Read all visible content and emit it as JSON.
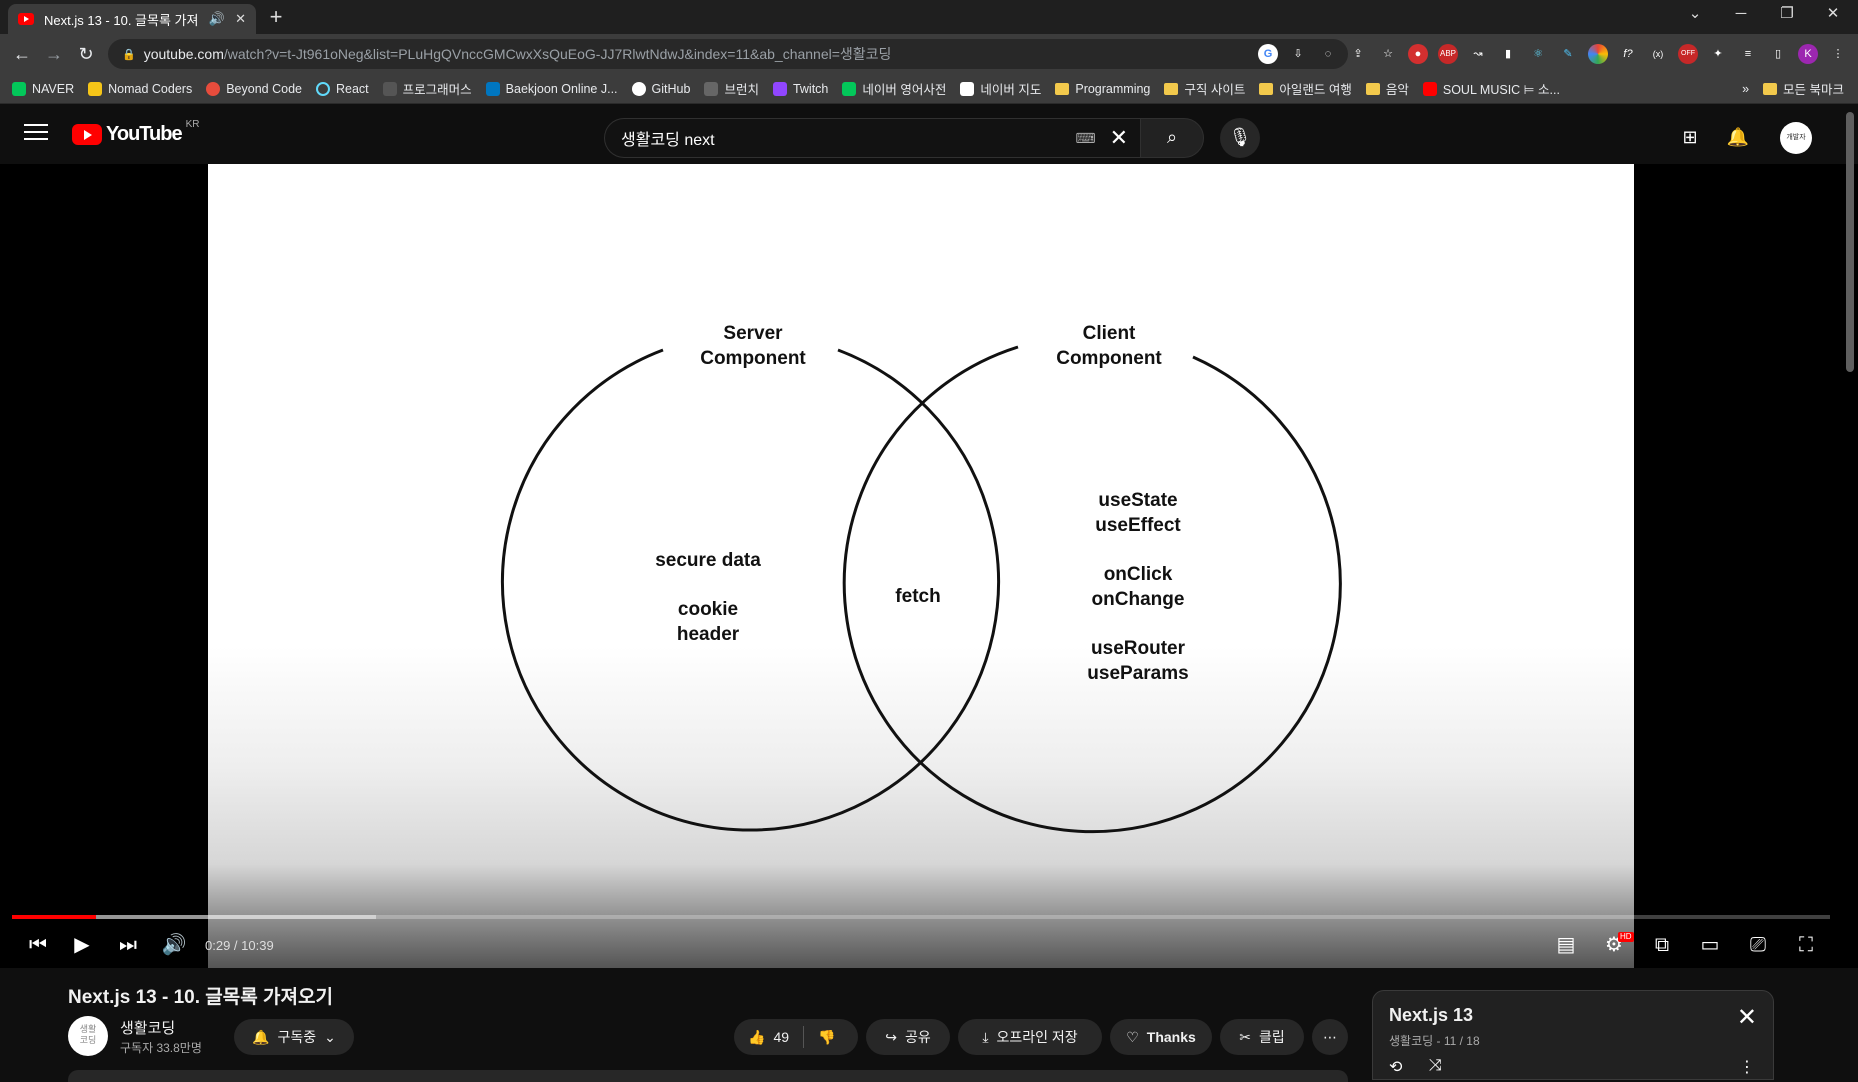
{
  "browser": {
    "tab_title": "Next.js 13 - 10. 글목록 가져오기",
    "url_host": "youtube.com",
    "url_rest": "/watch?v=t-Jt961oNeg&list=PLuHgQVnccGMCwxXsQuEoG-JJ7RlwtNdwJ&index=11&ab_channel=생활코딩",
    "bookmarks": [
      {
        "label": "NAVER",
        "color": "#03c75a"
      },
      {
        "label": "Nomad Coders",
        "color": "#f5c518"
      },
      {
        "label": "Beyond Code",
        "color": "#e74c3c"
      },
      {
        "label": "React",
        "color": "#61dafb"
      },
      {
        "label": "프로그래머스",
        "color": "#ffffff"
      },
      {
        "label": "Baekjoon Online J...",
        "color": "#0076c0"
      },
      {
        "label": "GitHub",
        "color": "#ffffff"
      },
      {
        "label": "브런치",
        "color": "#ffffff"
      },
      {
        "label": "Twitch",
        "color": "#9146ff"
      },
      {
        "label": "네이버 영어사전",
        "color": "#03c75a"
      },
      {
        "label": "네이버 지도",
        "color": "#ffffff"
      },
      {
        "label": "Programming",
        "color": "folder"
      },
      {
        "label": "구직 사이트",
        "color": "folder"
      },
      {
        "label": "아일랜드 여행",
        "color": "folder"
      },
      {
        "label": "음악",
        "color": "folder"
      },
      {
        "label": "SOUL MUSIC ⊨ 소...",
        "color": "#ff0000"
      }
    ],
    "bookmarks_more": "»",
    "all_bookmarks": "모든 북마크"
  },
  "masthead": {
    "logo_text": "YouTube",
    "region": "KR",
    "search_value": "생활코딩 next",
    "avatar_text": "개발자"
  },
  "slide": {
    "server_title": "Server\nComponent",
    "client_title": "Client\nComponent",
    "server_items": "secure data\n\ncookie\nheader",
    "overlap_items": "fetch",
    "client_items": "useState\nuseEffect\n\nonClick\nonChange\n\nuseRouter\nuseParams"
  },
  "player": {
    "time": "0:29 / 10:39",
    "played_fraction": 0.046,
    "buffered_fraction": 0.2,
    "hd_badge": "HD"
  },
  "video": {
    "title": "Next.js 13 - 10. 글목록 가져오기",
    "channel": "생활코딩",
    "channel_avatar": "생활\n코딩",
    "subscribers": "구독자 33.8만명",
    "subscribe_label": "구독중",
    "likes": "49",
    "share_label": "공유",
    "download_label": "오프라인 저장",
    "thanks_label": "Thanks",
    "clip_label": "클립",
    "more_label": "⋯"
  },
  "playlist": {
    "title": "Next.js 13",
    "subtitle": "생활코딩 - 11 / 18"
  },
  "colors": {
    "accent": "#ff0000",
    "background": "#0f0f0f"
  }
}
